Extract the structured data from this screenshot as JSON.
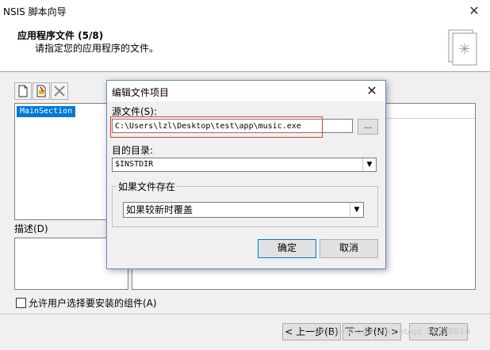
{
  "window": {
    "title": "NSIS 脚本向导"
  },
  "header": {
    "heading": "应用程序文件 (5/8)",
    "subtitle": "请指定您的应用程序的文件。"
  },
  "sections": {
    "items": [
      "MainSection"
    ]
  },
  "description": {
    "label": "描述(D)"
  },
  "options": {
    "allow_component_select": "允许用户选择要安装的组件(A)"
  },
  "wizard_buttons": {
    "back": "< 上一步(B)",
    "next": "下一步(N) >",
    "cancel": "取消"
  },
  "dialog": {
    "title": "编辑文件项目",
    "source_label": "源文件(S):",
    "source_value": "C:\\Users\\lzl\\Desktop\\test\\app\\music.exe",
    "browse_label": "...",
    "dest_label": "目的目录:",
    "dest_value": "$INSTDIR",
    "exist_group_label": "如果文件存在",
    "exist_value": "如果较新时覆盖",
    "ok_label": "确定",
    "cancel_label": "取消"
  },
  "watermark": "https://blog.csdn.net/qq_36588814",
  "colors": {
    "accent": "#0078d7",
    "highlight": "#e33a3a"
  }
}
